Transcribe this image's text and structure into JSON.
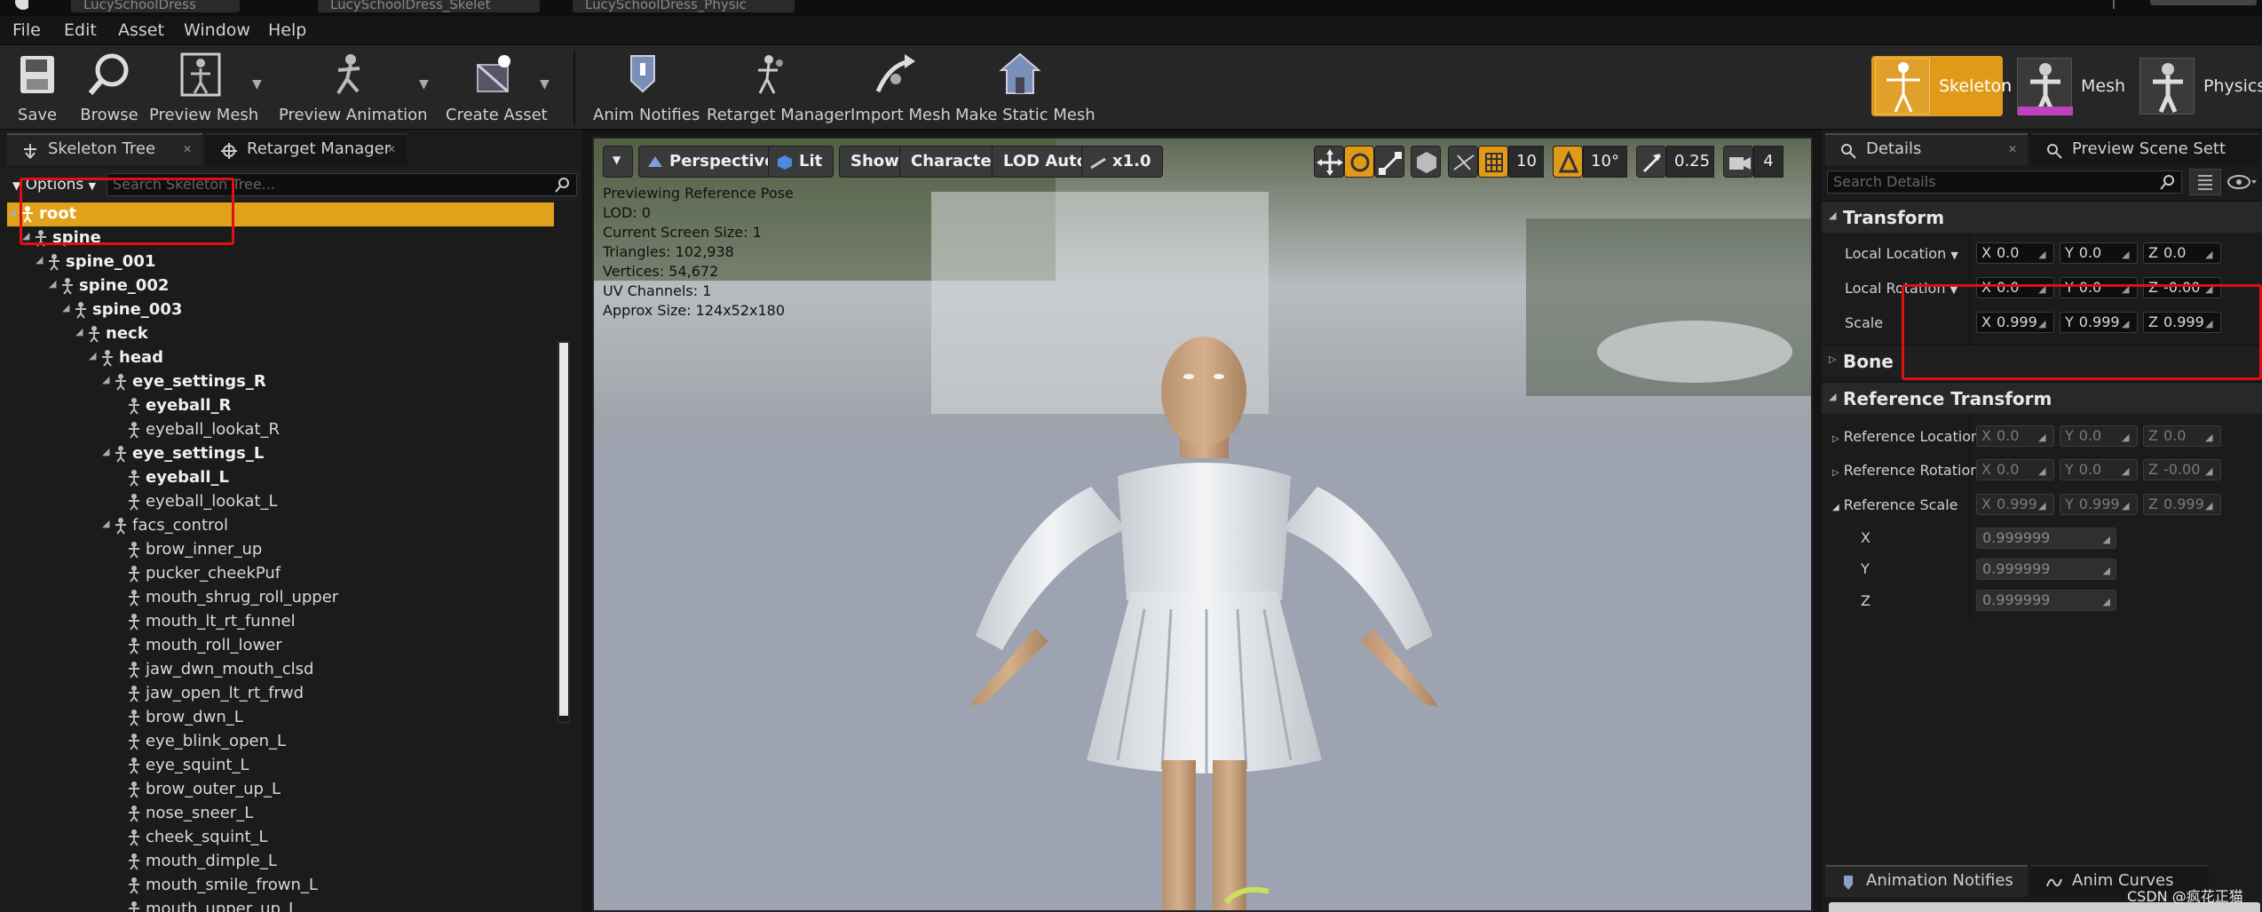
{
  "doc_tabs": [
    "LucySchoolDress",
    "LucySchoolDress_Skelet",
    "LucySchoolDress_Physic"
  ],
  "menu": [
    "File",
    "Edit",
    "Asset",
    "Window",
    "Help"
  ],
  "toolbar": {
    "buttons": [
      {
        "label": "Save",
        "icon": "save-icon"
      },
      {
        "label": "Browse",
        "icon": "browse-icon"
      },
      {
        "label": "Preview Mesh",
        "icon": "preview-mesh-icon"
      },
      {
        "label": "Preview Animation",
        "icon": "preview-animation-icon"
      },
      {
        "label": "Create Asset",
        "icon": "create-asset-icon"
      },
      {
        "label": "Anim Notifies",
        "icon": "anim-notifies-icon"
      },
      {
        "label": "Retarget Manager",
        "icon": "retarget-manager-icon"
      },
      {
        "label": "Import Mesh",
        "icon": "import-mesh-icon"
      },
      {
        "label": "Make Static Mesh",
        "icon": "make-static-mesh-icon"
      }
    ],
    "modes": [
      {
        "label": "Skeleton",
        "active": true
      },
      {
        "label": "Mesh",
        "active": false
      },
      {
        "label": "Physics",
        "active": false
      }
    ]
  },
  "left_panel": {
    "tabs": [
      "Skeleton Tree",
      "Retarget Manager"
    ],
    "options_label": "Options",
    "search_placeholder": "Search Skeleton Tree...",
    "bones": [
      {
        "name": "root",
        "bold": true,
        "selected": true,
        "expanded": true
      },
      {
        "name": "spine",
        "bold": true,
        "expanded": true
      },
      {
        "name": "spine_001",
        "bold": true,
        "expanded": true
      },
      {
        "name": "spine_002",
        "bold": true,
        "expanded": true
      },
      {
        "name": "spine_003",
        "bold": true,
        "expanded": true
      },
      {
        "name": "neck",
        "bold": true,
        "expanded": true
      },
      {
        "name": "head",
        "bold": true,
        "expanded": true
      },
      {
        "name": "eye_settings_R",
        "bold": true,
        "expanded": true
      },
      {
        "name": "eyeball_R",
        "bold": true
      },
      {
        "name": "eyeball_lookat_R",
        "bold": false
      },
      {
        "name": "eye_settings_L",
        "bold": true,
        "expanded": true
      },
      {
        "name": "eyeball_L",
        "bold": true
      },
      {
        "name": "eyeball_lookat_L",
        "bold": false
      },
      {
        "name": "facs_control",
        "bold": false,
        "expanded": true
      },
      {
        "name": "brow_inner_up",
        "bold": false
      },
      {
        "name": "pucker_cheekPuf",
        "bold": false
      },
      {
        "name": "mouth_shrug_roll_upper",
        "bold": false
      },
      {
        "name": "mouth_lt_rt_funnel",
        "bold": false
      },
      {
        "name": "mouth_roll_lower",
        "bold": false
      },
      {
        "name": "jaw_dwn_mouth_clsd",
        "bold": false
      },
      {
        "name": "jaw_open_lt_rt_frwd",
        "bold": false
      },
      {
        "name": "brow_dwn_L",
        "bold": false
      },
      {
        "name": "eye_blink_open_L",
        "bold": false
      },
      {
        "name": "eye_squint_L",
        "bold": false
      },
      {
        "name": "brow_outer_up_L",
        "bold": false
      },
      {
        "name": "nose_sneer_L",
        "bold": false
      },
      {
        "name": "cheek_squint_L",
        "bold": false
      },
      {
        "name": "mouth_dimple_L",
        "bold": false
      },
      {
        "name": "mouth_smile_frown_L",
        "bold": false
      },
      {
        "name": "mouth_upper_up_L",
        "bold": false
      }
    ]
  },
  "viewport": {
    "buttons": {
      "perspective": "Perspective",
      "lit": "Lit",
      "show": "Show",
      "character": "Character",
      "lod": "LOD Auto",
      "speed": "x1.0"
    },
    "snap": {
      "grid": "10",
      "rotation": "10°",
      "scale": "0.25",
      "camera_speed": "4"
    },
    "stats": [
      "Previewing Reference Pose",
      "LOD: 0",
      "Current Screen Size: 1",
      "Triangles: 102,938",
      "Vertices: 54,672",
      "UV Channels: 1",
      "Approx Size: 124x52x180"
    ]
  },
  "right_panel": {
    "tabs": [
      "Details",
      "Preview Scene Sett"
    ],
    "search_placeholder": "Search Details",
    "transform": {
      "title": "Transform",
      "location_label": "Local Location",
      "rotation_label": "Local Rotation",
      "scale_label": "Scale",
      "location": [
        "0.0",
        "0.0",
        "0.0"
      ],
      "rotation": [
        "0.0",
        "0.0",
        "-0.00"
      ],
      "scale": [
        "0.999",
        "0.999",
        "0.999"
      ]
    },
    "bone_title": "Bone",
    "reference": {
      "title": "Reference Transform",
      "location_label": "Reference Location",
      "rotation_label": "Reference Rotation",
      "scale_label": "Reference Scale",
      "location": [
        "0.0",
        "0.0",
        "0.0"
      ],
      "rotation": [
        "0.0",
        "0.0",
        "-0.00"
      ],
      "scale": [
        "0.999",
        "0.999",
        "0.999"
      ],
      "x_label": "X",
      "y_label": "Y",
      "z_label": "Z",
      "x_value": "0.999999",
      "y_value": "0.999999",
      "z_value": "0.999999"
    },
    "bottom_tabs": [
      "Animation Notifies",
      "Anim Curves"
    ],
    "watermark": "CSDN @疯花正猫"
  },
  "colors": {
    "selected_row": "#e0a21a",
    "mode_active": "#e09a18",
    "highlight_box": "#e01010"
  }
}
